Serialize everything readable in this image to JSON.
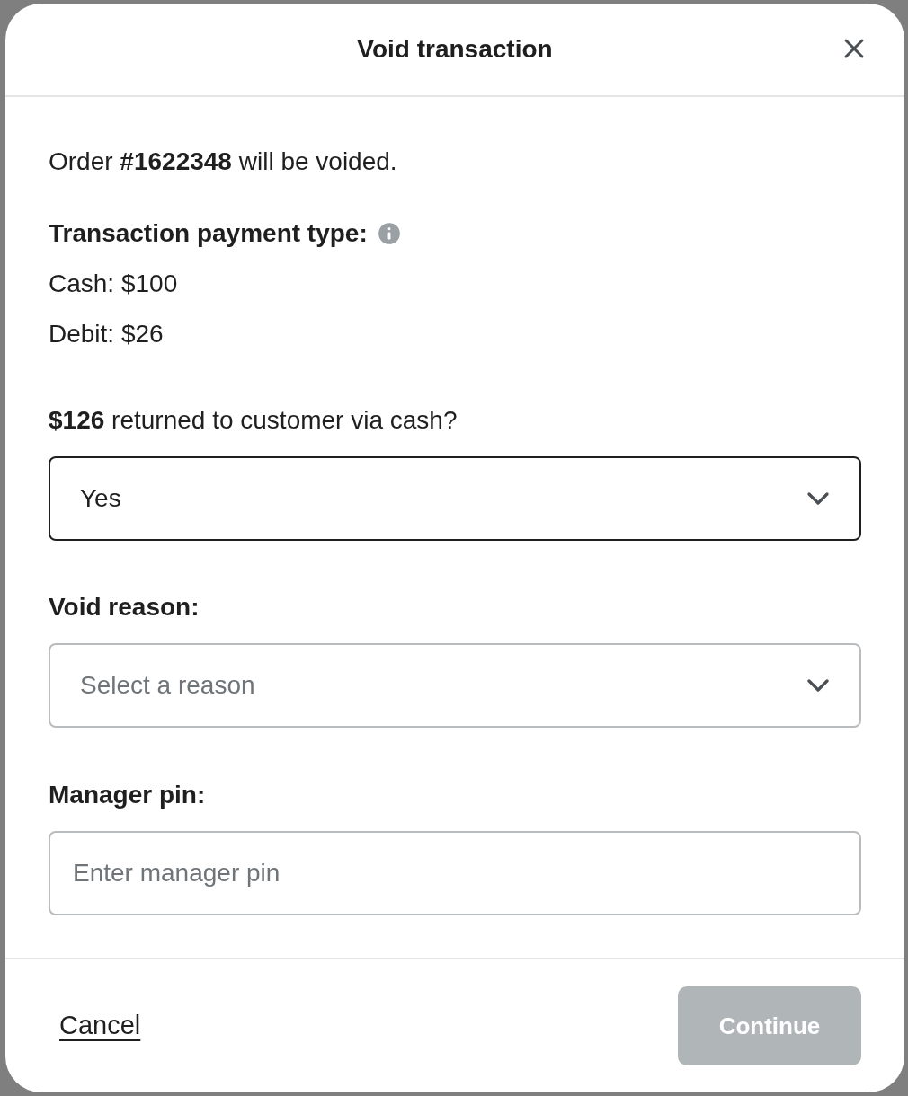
{
  "dialog": {
    "title": "Void transaction"
  },
  "message": "Order **#1622348** will be voided.",
  "payment_type": {
    "label": "Transaction payment type:",
    "items": [
      "Cash: $100",
      "Debit: $26"
    ]
  },
  "cash_question": {
    "label": "**$126** returned to customer via cash?",
    "value": "Yes"
  },
  "void_reason": {
    "label": "Void reason:",
    "placeholder": "Select a reason"
  },
  "manager_pin": {
    "label": "Manager pin:",
    "placeholder": "Enter manager pin"
  },
  "footer": {
    "cancel": "Cancel",
    "continue": {
      "label": "Continue",
      "disabled": true
    }
  }
}
